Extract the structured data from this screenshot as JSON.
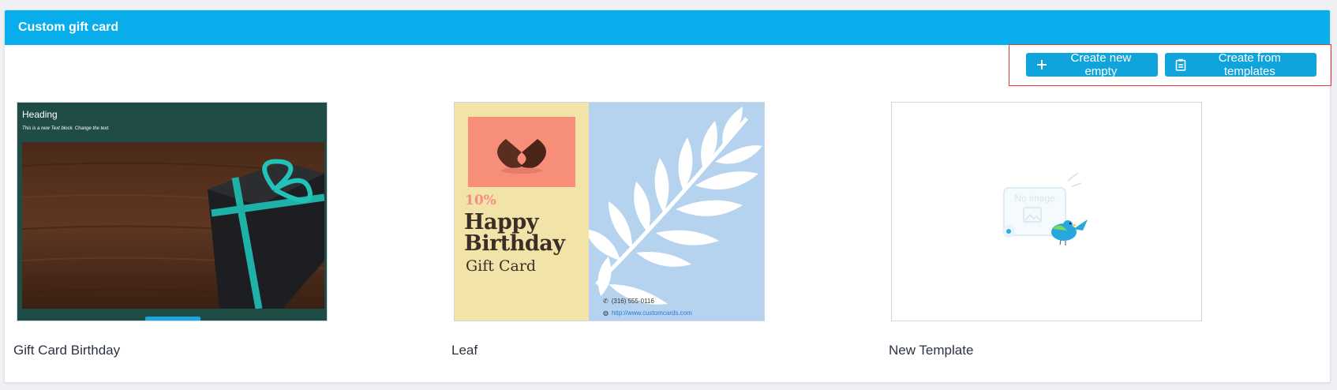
{
  "panel": {
    "title": "Custom gift card"
  },
  "toolbar": {
    "create_empty_label": "Create new empty",
    "create_templates_label": "Create from templates"
  },
  "templates": [
    {
      "name": "Gift Card Birthday",
      "preview": {
        "heading": "Heading",
        "text": "This is a new Text block. Change the text."
      }
    },
    {
      "name": "Leaf",
      "preview": {
        "discount": "10%",
        "headline": "Happy Birthday",
        "subtitle": "Gift Card",
        "phone": "(316) 555-0116",
        "url": "http://www.customcards.com"
      }
    },
    {
      "name": "New Template",
      "preview": {
        "placeholder": "No image"
      }
    }
  ],
  "colors": {
    "header": "#08aeec",
    "button": "#0fa4dc",
    "highlight": "#e53935"
  }
}
